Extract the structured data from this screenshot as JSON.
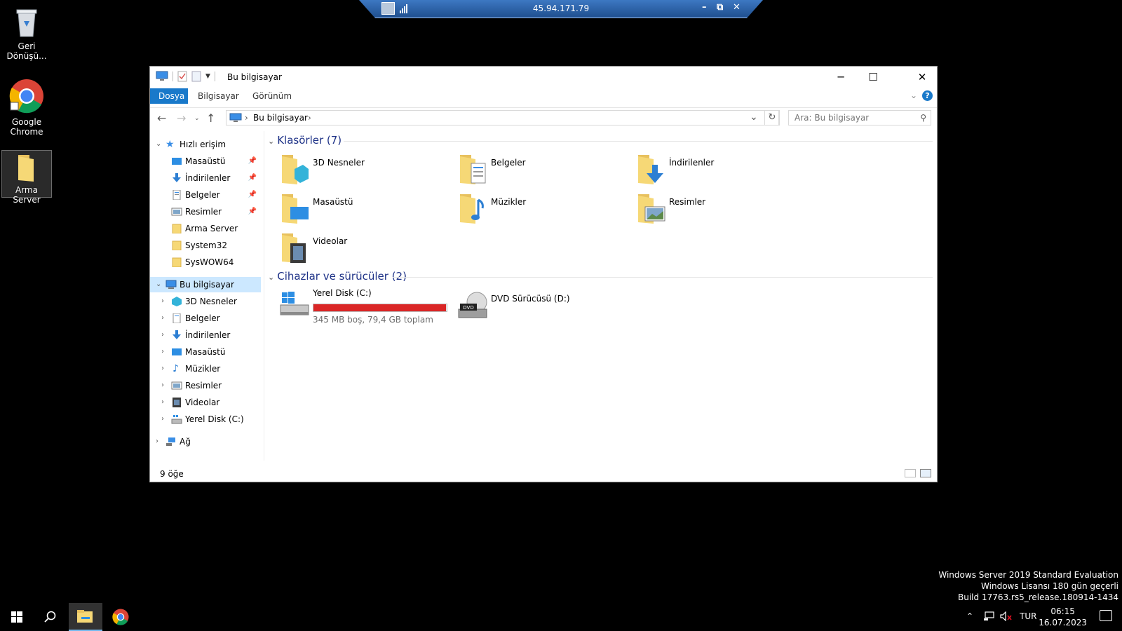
{
  "desktop": {
    "icons": [
      {
        "label": "Geri Dönüşü..."
      },
      {
        "label": "Google Chrome"
      },
      {
        "label": "Arma Server"
      }
    ]
  },
  "rdp": {
    "host": "45.94.171.79"
  },
  "window": {
    "title": "Bu bilgisayar",
    "ribbon_tabs": [
      "Dosya",
      "Bilgisayar",
      "Görünüm"
    ],
    "help_glyph": "?",
    "address": {
      "crumb": "Bu bilgisayar"
    },
    "search": {
      "placeholder": "Ara: Bu bilgisayar"
    },
    "nav": {
      "quick_access": "Hızlı erişim",
      "quick_items": [
        "Masaüstü",
        "İndirilenler",
        "Belgeler",
        "Resimler",
        "Arma Server",
        "System32",
        "SysWOW64"
      ],
      "this_pc": "Bu bilgisayar",
      "pc_items": [
        "3D Nesneler",
        "Belgeler",
        "İndirilenler",
        "Masaüstü",
        "Müzikler",
        "Resimler",
        "Videolar",
        "Yerel Disk (C:)"
      ],
      "network": "Ağ"
    },
    "folders_header": "Klasörler (7)",
    "folders": [
      "3D Nesneler",
      "Belgeler",
      "İndirilenler",
      "Masaüstü",
      "Müzikler",
      "Resimler",
      "Videolar"
    ],
    "devices_header": "Cihazlar ve sürücüler (2)",
    "drives": [
      {
        "name": "Yerel Disk (C:)",
        "info": "345 MB boş, 79,4 GB toplam",
        "used_fraction": 0.996
      },
      {
        "name": "DVD Sürücüsü (D:)",
        "badge": "DVD"
      }
    ],
    "status": "9 öğe"
  },
  "watermark": {
    "line1": "Windows Server 2019 Standard Evaluation",
    "line2": "Windows Lisansı 180 gün geçerli",
    "line3": "Build 17763.rs5_release.180914-1434"
  },
  "taskbar": {
    "lang": "TUR",
    "time": "06:15",
    "date": "16.07.2023"
  },
  "colors": {
    "accent": "#1979ca",
    "drive_full": "#da2626",
    "selection": "#cce8ff"
  }
}
